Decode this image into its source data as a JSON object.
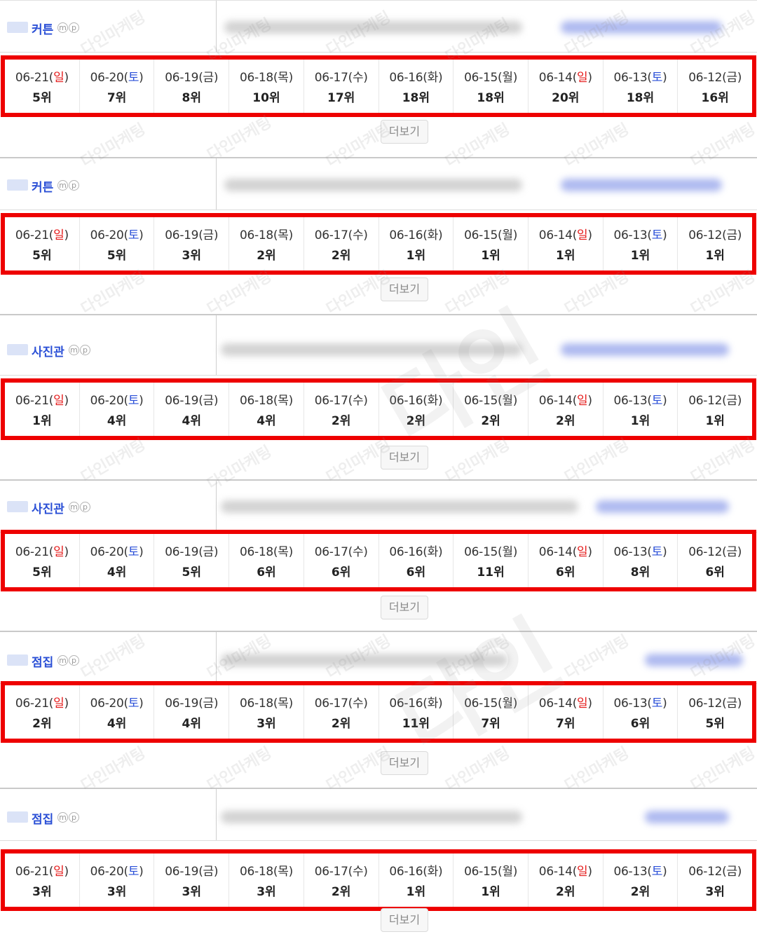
{
  "more_label": "더보기",
  "mp": [
    "m",
    "p"
  ],
  "watermark": "다인마케팅",
  "colors": {
    "sunday": "#e51b1b",
    "saturday": "#2a4fd8",
    "highlight_border": "#ee0000",
    "keyword": "#2b50d6"
  },
  "dates": [
    {
      "md": "06-21",
      "dow": "일",
      "kind": "sun"
    },
    {
      "md": "06-20",
      "dow": "토",
      "kind": "sat"
    },
    {
      "md": "06-19",
      "dow": "금",
      "kind": "week"
    },
    {
      "md": "06-18",
      "dow": "목",
      "kind": "week"
    },
    {
      "md": "06-17",
      "dow": "수",
      "kind": "week"
    },
    {
      "md": "06-16",
      "dow": "화",
      "kind": "week"
    },
    {
      "md": "06-15",
      "dow": "월",
      "kind": "week"
    },
    {
      "md": "06-14",
      "dow": "일",
      "kind": "sun"
    },
    {
      "md": "06-13",
      "dow": "토",
      "kind": "sat"
    },
    {
      "md": "06-12",
      "dow": "금",
      "kind": "week"
    }
  ],
  "rows": [
    {
      "keyword": "커튼",
      "ranks": [
        "5위",
        "7위",
        "8위",
        "10위",
        "17위",
        "18위",
        "18위",
        "20위",
        "18위",
        "16위"
      ]
    },
    {
      "keyword": "커튼",
      "ranks": [
        "5위",
        "5위",
        "3위",
        "2위",
        "2위",
        "1위",
        "1위",
        "1위",
        "1위",
        "1위"
      ]
    },
    {
      "keyword": "사진관",
      "ranks": [
        "1위",
        "4위",
        "4위",
        "4위",
        "2위",
        "2위",
        "2위",
        "2위",
        "1위",
        "1위"
      ]
    },
    {
      "keyword": "사진관",
      "ranks": [
        "5위",
        "4위",
        "5위",
        "6위",
        "6위",
        "6위",
        "11위",
        "6위",
        "8위",
        "6위"
      ]
    },
    {
      "keyword": "점집",
      "ranks": [
        "2위",
        "4위",
        "4위",
        "3위",
        "2위",
        "11위",
        "7위",
        "7위",
        "6위",
        "5위"
      ]
    },
    {
      "keyword": "점집",
      "ranks": [
        "3위",
        "3위",
        "3위",
        "3위",
        "2위",
        "1위",
        "1위",
        "2위",
        "2위",
        "3위"
      ]
    }
  ]
}
